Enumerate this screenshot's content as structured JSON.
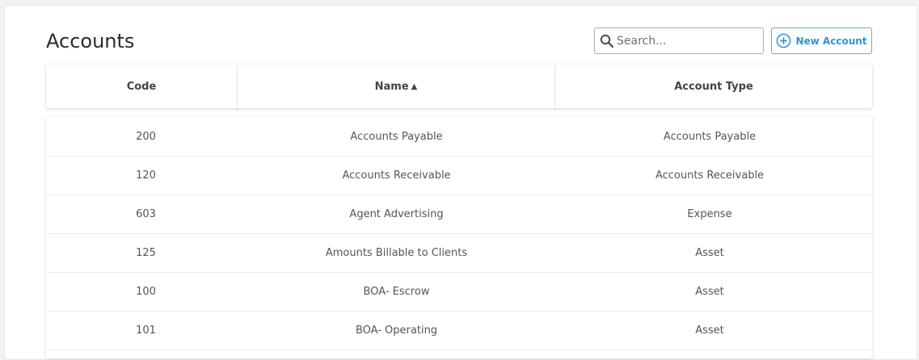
{
  "page": {
    "title": "Accounts"
  },
  "search": {
    "placeholder": "Search...",
    "value": ""
  },
  "actions": {
    "new_account_label": "New Account"
  },
  "colors": {
    "accent": "#2e95d6",
    "background": "#f3f3f3"
  },
  "table": {
    "columns": {
      "code": "Code",
      "name": "Name",
      "type": "Account Type"
    },
    "sort": {
      "column": "name",
      "direction": "ascending",
      "indicator": "▲"
    },
    "rows": [
      {
        "code": "200",
        "name": "Accounts Payable",
        "type": "Accounts Payable"
      },
      {
        "code": "120",
        "name": "Accounts Receivable",
        "type": "Accounts Receivable"
      },
      {
        "code": "603",
        "name": "Agent Advertising",
        "type": "Expense"
      },
      {
        "code": "125",
        "name": "Amounts Billable to Clients",
        "type": "Asset"
      },
      {
        "code": "100",
        "name": "BOA- Escrow",
        "type": "Asset"
      },
      {
        "code": "101",
        "name": "BOA- Operating",
        "type": "Asset"
      }
    ]
  }
}
